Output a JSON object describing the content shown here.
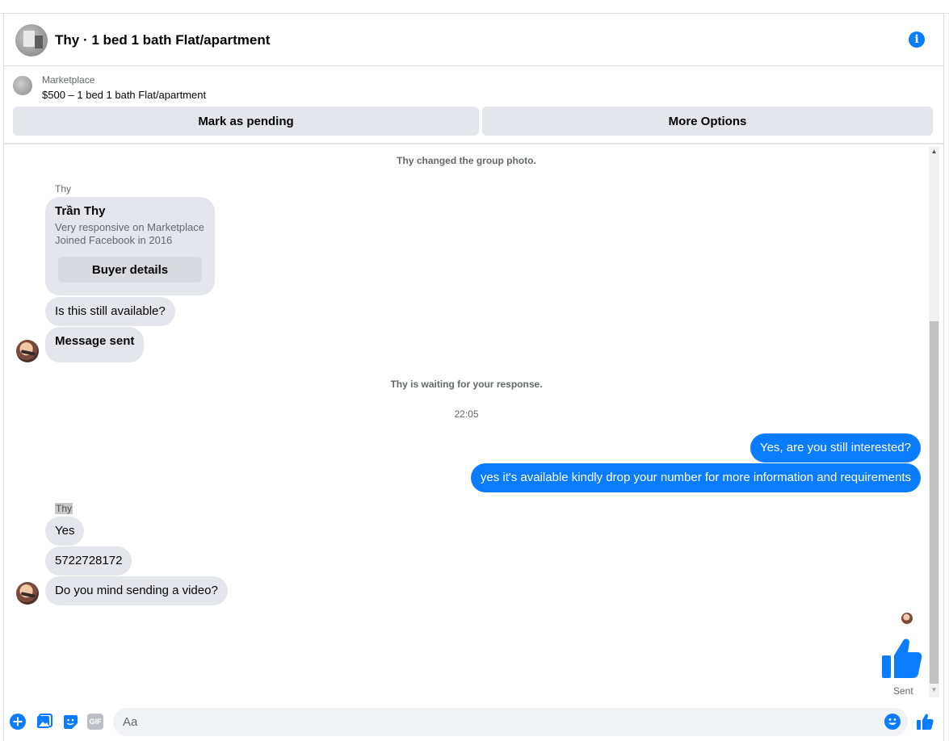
{
  "header": {
    "title": "Thy · 1 bed 1 bath Flat/apartment",
    "info_icon": "info-icon"
  },
  "marketplace": {
    "label": "Marketplace",
    "listing": "$500 – 1 bed 1 bath Flat/apartment",
    "pending_button": "Mark as pending",
    "more_button": "More Options"
  },
  "conversation": {
    "system_group_photo": "Thy changed the group photo.",
    "first_sender": "Thy",
    "buyer_card": {
      "name": "Trần Thy",
      "line1": "Very responsive on Marketplace",
      "line2": "Joined Facebook in 2016",
      "button": "Buyer details"
    },
    "in_msg_1": "Is this still available?",
    "in_msg_2": "Message sent",
    "system_waiting": "Thy is waiting for your response.",
    "timestamp": "22:05",
    "out_msg_1": "Yes, are you still interested?",
    "out_msg_2": "yes it's available kindly drop your number for more information and requirements",
    "second_sender": "Thy",
    "in_msg_3": "Yes",
    "in_msg_4": "5722728172",
    "in_msg_5": "Do you mind sending a video?",
    "sent_status": "Sent"
  },
  "composer": {
    "placeholder": "Aa",
    "gif_label": "GIF"
  },
  "colors": {
    "accent": "#0a7cff",
    "bubble_in": "#e4e6eb",
    "secondary_text": "#65676b"
  }
}
